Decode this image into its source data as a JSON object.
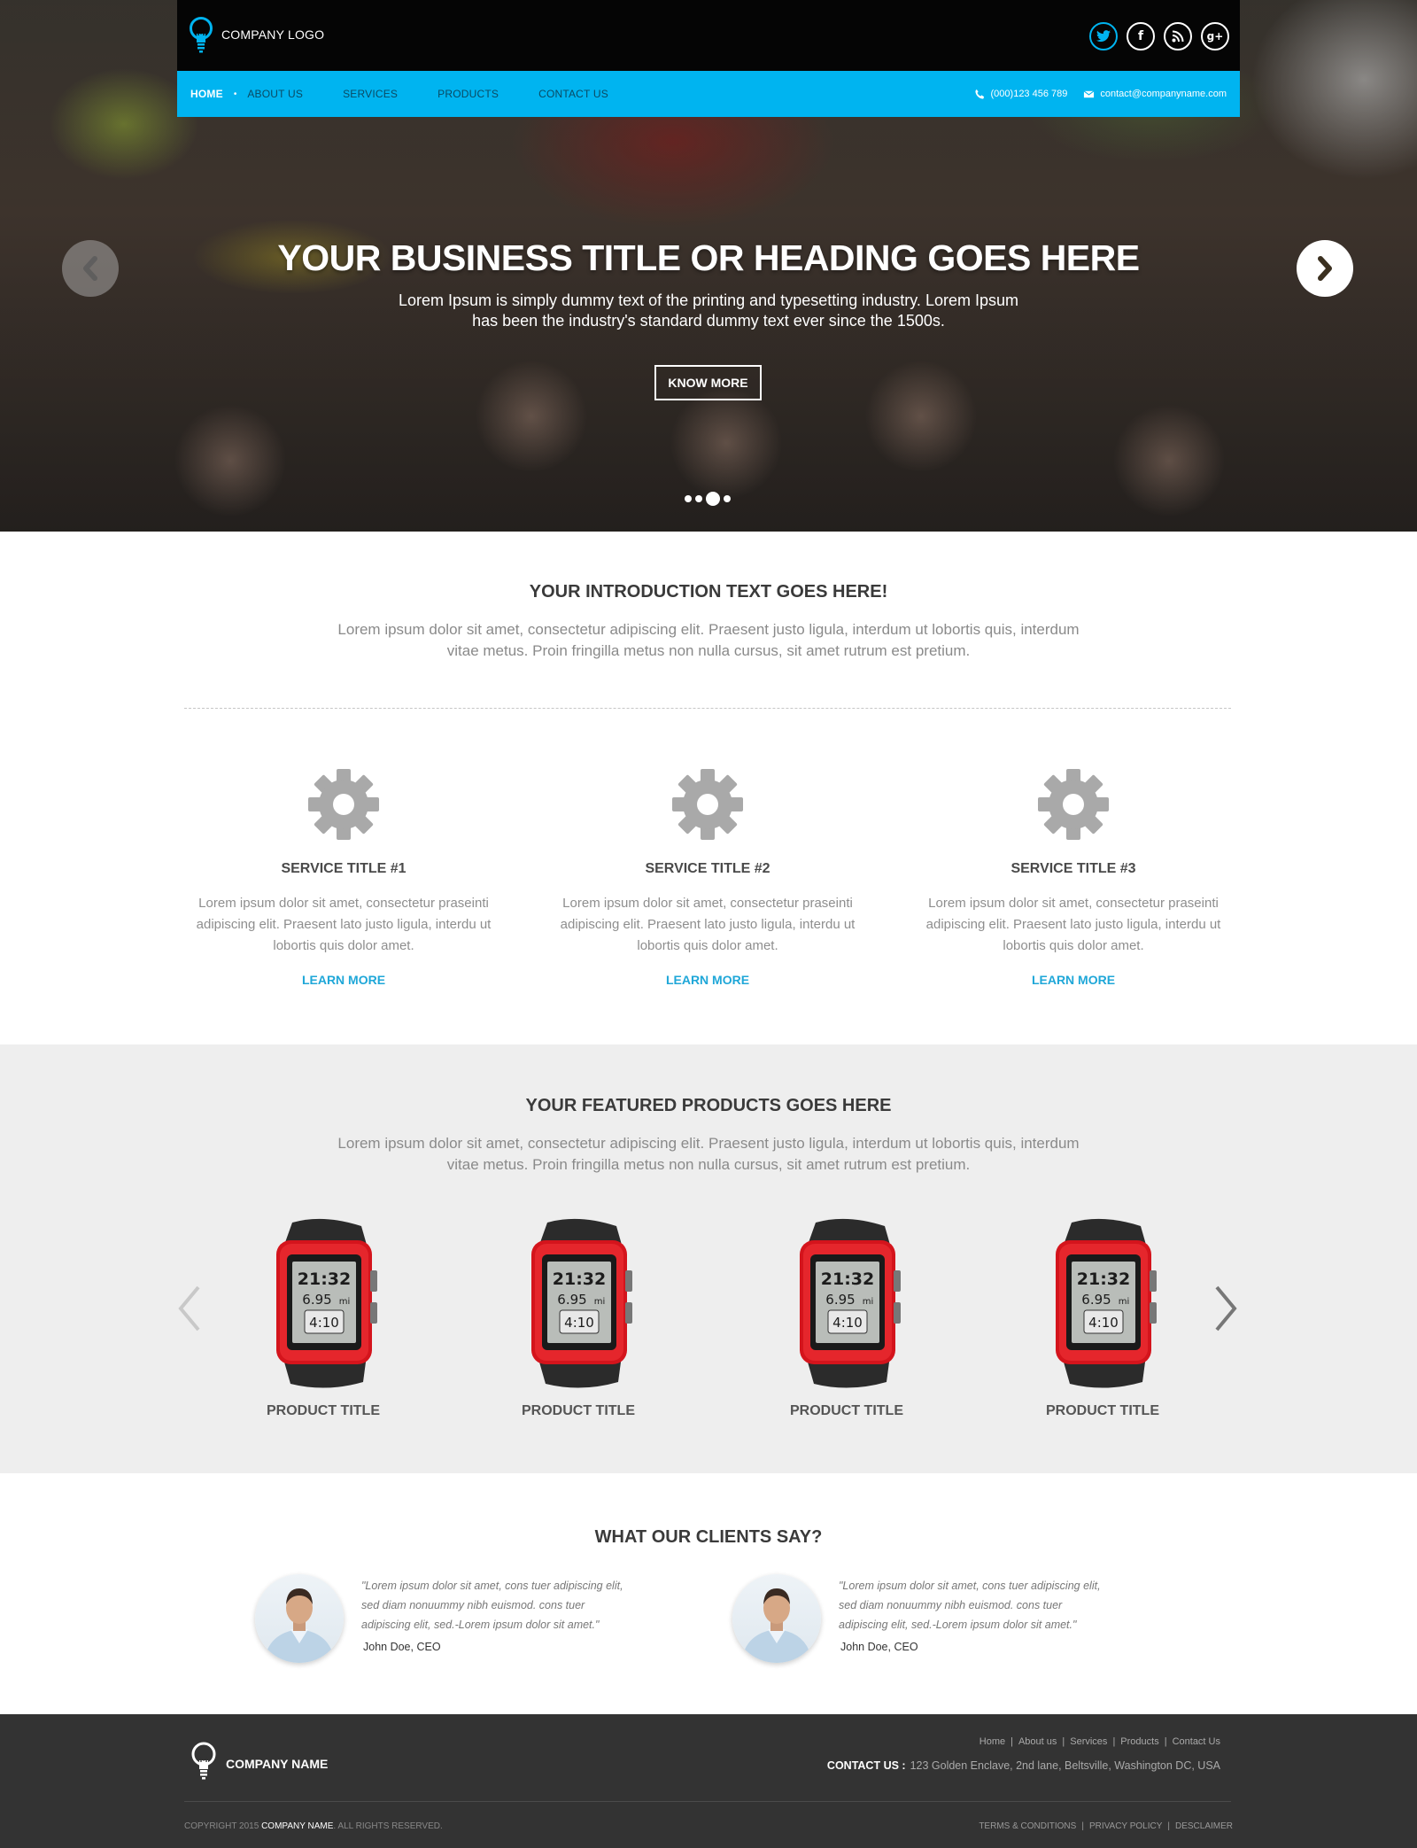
{
  "header": {
    "logo_text": "COMPANY LOGO",
    "social": [
      "twitter-icon",
      "facebook-icon",
      "rss-icon",
      "google-plus-icon"
    ],
    "social_glyphs": {
      "facebook": "f",
      "google_plus": "g+"
    }
  },
  "nav": {
    "items": [
      {
        "label": "HOME",
        "active": true
      },
      {
        "label": "ABOUT US"
      },
      {
        "label": "SERVICES"
      },
      {
        "label": "PRODUCTS"
      },
      {
        "label": "CONTACT US"
      }
    ],
    "phone": "(000)123 456 789",
    "email": "contact@companyname.com"
  },
  "hero": {
    "title": "YOUR BUSINESS TITLE OR HEADING GOES HERE",
    "subtitle": "Lorem Ipsum is simply dummy text of the printing and typesetting industry. Lorem Ipsum has been the industry's standard dummy text ever since the 1500s.",
    "button_label": "KNOW MORE",
    "slide_count": 4,
    "active_slide": 3
  },
  "intro": {
    "title": "YOUR INTRODUCTION TEXT GOES HERE!",
    "text": "Lorem ipsum dolor sit amet, consectetur adipiscing elit. Praesent justo ligula, interdum ut lobortis quis, interdum vitae metus. Proin fringilla metus non nulla cursus, sit amet rutrum est pretium."
  },
  "services": [
    {
      "title": "SERVICE TITLE #1",
      "text": "Lorem ipsum dolor sit amet, consectetur praseinti adipiscing elit. Praesent lato justo ligula, interdu ut lobortis quis dolor amet.",
      "link": "LEARN MORE",
      "icon": "gear-icon"
    },
    {
      "title": "SERVICE TITLE #2",
      "text": "Lorem ipsum dolor sit amet, consectetur praseinti adipiscing elit. Praesent lato justo ligula, interdu ut lobortis quis dolor amet.",
      "link": "LEARN MORE",
      "icon": "gear-icon"
    },
    {
      "title": "SERVICE TITLE #3",
      "text": "Lorem ipsum dolor sit amet, consectetur praseinti adipiscing elit. Praesent lato justo ligula, interdu ut lobortis quis dolor amet.",
      "link": "LEARN MORE",
      "icon": "gear-icon"
    }
  ],
  "products": {
    "title": "YOUR FEATURED PRODUCTS GOES HERE",
    "text": "Lorem ipsum dolor sit amet, consectetur adipiscing elit. Praesent justo ligula, interdum ut lobortis quis, interdum vitae metus. Proin fringilla metus non nulla cursus, sit amet rutrum est pretium.",
    "watch_display": {
      "time": "21:32",
      "distance": "6.95",
      "unit": "mi",
      "lap": "4:10"
    },
    "items": [
      {
        "title": "PRODUCT TITLE"
      },
      {
        "title": "PRODUCT TITLE"
      },
      {
        "title": "PRODUCT TITLE"
      },
      {
        "title": "PRODUCT TITLE"
      }
    ]
  },
  "testimonials": {
    "title": "WHAT OUR CLIENTS SAY?",
    "items": [
      {
        "quote": "\"Lorem ipsum dolor sit amet, cons tuer adipiscing elit, sed diam nonuummy nibh euismod. cons tuer adipiscing elit, sed.-Lorem ipsum dolor sit amet.\"",
        "author": "John Doe, CEO"
      },
      {
        "quote": "\"Lorem ipsum dolor sit amet, cons tuer adipiscing elit, sed diam nonuummy nibh euismod. cons tuer adipiscing elit, sed.-Lorem ipsum dolor sit amet.\"",
        "author": "John Doe, CEO"
      }
    ]
  },
  "footer": {
    "company_name": "COMPANY NAME",
    "links": [
      "Home",
      "About us",
      "Services",
      "Products",
      "Contact Us"
    ],
    "contact_label": "CONTACT US :",
    "address": "123 Golden Enclave, 2nd lane, Beltsville, Washington DC, USA",
    "copyright_prefix": "COPYRIGHT 2015",
    "copyright_name": "COMPANY NAME",
    "copyright_suffix": ". ALL RIGHTS RESERVED.",
    "legal_links": [
      "TERMS & CONDITIONS",
      "PRIVACY POLICY",
      "DESCLAIMER"
    ]
  },
  "colors": {
    "accent": "#00b4f0",
    "link": "#1fa7d8",
    "footer_bg": "#333333",
    "products_bg": "#eeeeee",
    "watch_red": "#d4141c"
  }
}
